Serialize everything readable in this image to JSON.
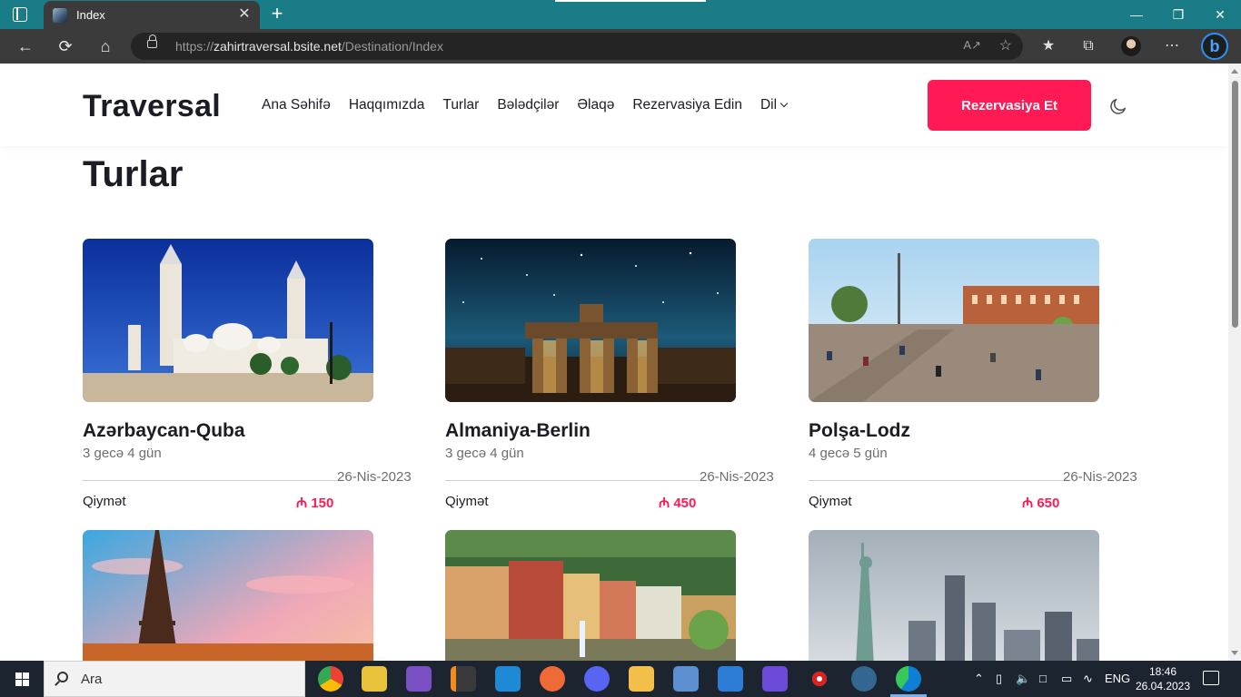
{
  "browser": {
    "tab_title": "Index",
    "url_scheme": "https://",
    "url_host": "zahirtraversal.bsite.net",
    "url_path": "/Destination/Index",
    "close_glyph": "✕",
    "new_tab_glyph": "+",
    "min_glyph": "—",
    "max_glyph": "❐",
    "wclose_glyph": "✕"
  },
  "site": {
    "logo": "Traversal",
    "nav": [
      "Ana Səhifə",
      "Haqqımızda",
      "Turlar",
      "Bələdçilər",
      "Əlaqə",
      "Rezervasiya Edin",
      "Dil"
    ],
    "cta": "Rezervasiya Et",
    "theme_icon": "moon-icon",
    "accent_color": "#ff1a55"
  },
  "page": {
    "title": "Turlar",
    "price_label": "Qiymət",
    "currency_symbol": "₼"
  },
  "tours": [
    {
      "name": "Azərbaycan-Quba",
      "duration": "3 gecə 4 gün",
      "date": "26-Nis-2023",
      "price": "150"
    },
    {
      "name": "Almaniya-Berlin",
      "duration": "3 gecə 4 gün",
      "date": "26-Nis-2023",
      "price": "450"
    },
    {
      "name": "Polşa-Lodz",
      "duration": "4 gecə 5 gün",
      "date": "26-Nis-2023",
      "price": "650"
    }
  ],
  "taskbar": {
    "search_placeholder": "Ara",
    "lang": "ENG",
    "time": "18:46",
    "date": "26.04.2023"
  }
}
